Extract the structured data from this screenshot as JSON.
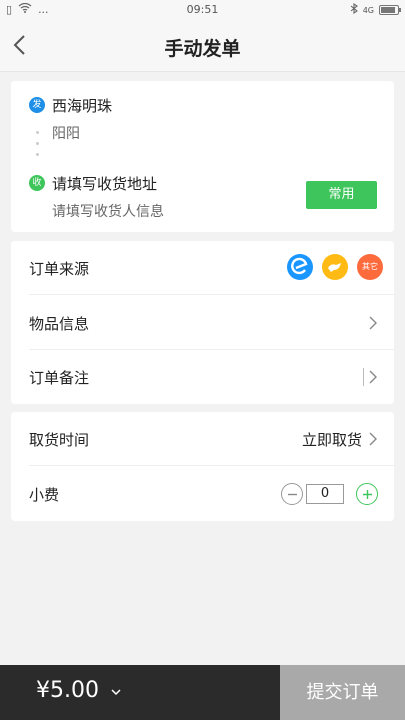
{
  "status_bar": {
    "time": "09:51",
    "signal_text": "...",
    "net": "4G"
  },
  "nav": {
    "title": "手动发单"
  },
  "address": {
    "sender_badge": "发",
    "sender_name": "西海明珠",
    "sender_contact": "阳阳",
    "receiver_badge": "收",
    "receiver_address_placeholder": "请填写收货地址",
    "receiver_contact_placeholder": "请填写收货人信息",
    "common_button": "常用"
  },
  "order": {
    "source_label": "订单来源",
    "sources": [
      {
        "name": "ele",
        "icon": "ele-icon",
        "color": "#1996ff"
      },
      {
        "name": "meituan",
        "icon": "kangaroo-icon",
        "color": "#ffba13"
      },
      {
        "name": "other",
        "label": "其它",
        "color": "#fd6a3c"
      }
    ],
    "goods_label": "物品信息",
    "note_label": "订单备注"
  },
  "pickup": {
    "time_label": "取货时间",
    "time_value": "立即取货",
    "tip_label": "小费",
    "tip_value": "0"
  },
  "footer": {
    "price": "¥5.00",
    "submit_label": "提交订单"
  },
  "colors": {
    "accent_green": "#3ec65c",
    "accent_blue": "#1e8fe8",
    "footer_dark": "#2b2b2b",
    "submit_gray": "#a9a9a9"
  }
}
